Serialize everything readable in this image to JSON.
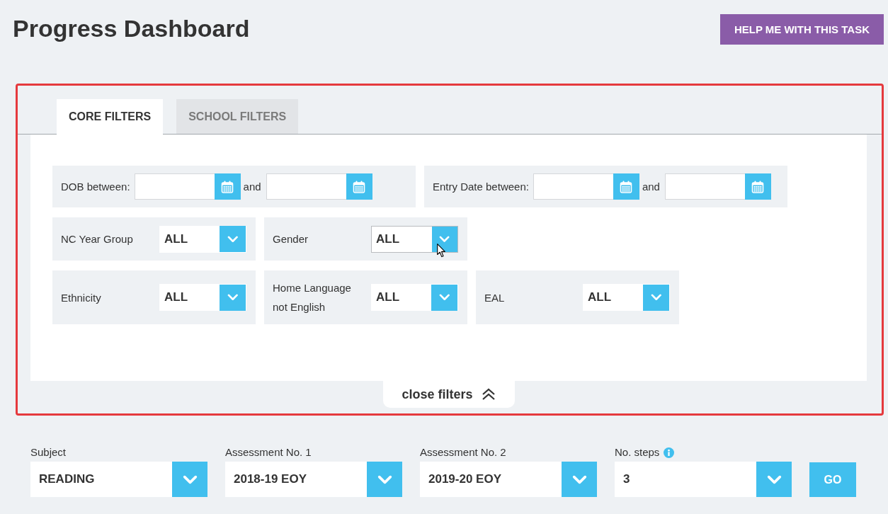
{
  "header": {
    "title": "Progress Dashboard",
    "help_button": "HELP ME WITH THIS TASK"
  },
  "filters_panel": {
    "tabs": [
      {
        "label": "CORE FILTERS",
        "selected": true
      },
      {
        "label": "SCHOOL FILTERS",
        "selected": false
      }
    ],
    "filter_rows": [
      {
        "filters": [
          {
            "kind": "date_range",
            "label": "DOB between:",
            "connector": "and"
          },
          {
            "kind": "date_range",
            "label": "Entry Date between:",
            "connector": "and"
          }
        ]
      },
      {
        "filters": [
          {
            "kind": "select",
            "label": "NC Year Group",
            "value": "ALL",
            "focused": false
          },
          {
            "kind": "select",
            "label": "Gender",
            "value": "ALL",
            "focused": true
          }
        ]
      },
      {
        "filters": [
          {
            "kind": "select",
            "label": "Ethnicity",
            "value": "ALL",
            "focused": false
          },
          {
            "kind": "select",
            "label": "Home Language not English",
            "value": "ALL",
            "focused": false
          },
          {
            "kind": "select",
            "label": "EAL",
            "value": "ALL",
            "focused": false
          }
        ]
      }
    ],
    "close_toggle": "close filters"
  },
  "report_options": [
    {
      "label": "Subject",
      "value": "READING",
      "info": false
    },
    {
      "label": "Assessment No. 1",
      "value": "2018-19 EOY",
      "info": false
    },
    {
      "label": "Assessment No. 2",
      "value": "2019-20 EOY",
      "info": false
    },
    {
      "label": "No. steps",
      "value": "3",
      "info": true
    }
  ],
  "go_button": "GO"
}
